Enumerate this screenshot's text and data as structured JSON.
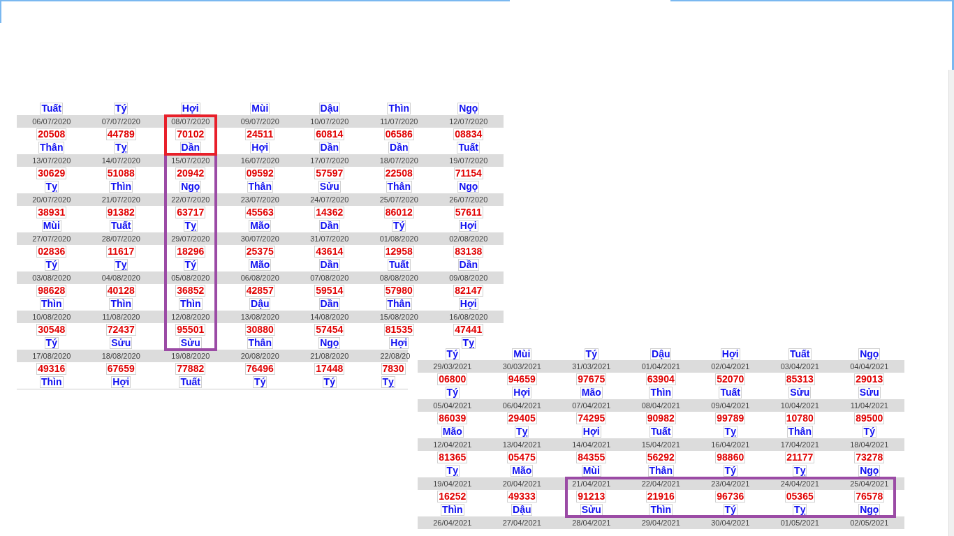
{
  "tables": [
    {
      "weeks": [
        {
          "days": [
            {
              "zodiac": "Tuất"
            },
            {
              "zodiac": "Tý"
            },
            {
              "zodiac": "Hợi"
            },
            {
              "zodiac": "Mùi"
            },
            {
              "zodiac": "Dậu"
            },
            {
              "zodiac": "Thìn"
            },
            {
              "zodiac": "Ngọ"
            }
          ]
        },
        {
          "days": [
            {
              "date": "06/07/2020",
              "number": "20508",
              "zodiac": "Thân"
            },
            {
              "date": "07/07/2020",
              "number": "44789",
              "zodiac": "Tỵ"
            },
            {
              "date": "08/07/2020",
              "number": "70102",
              "zodiac": "Dần",
              "frames": [
                {
                  "color": "#e8202a"
                }
              ]
            },
            {
              "date": "09/07/2020",
              "number": "24511",
              "zodiac": "Hợi"
            },
            {
              "date": "10/07/2020",
              "number": "60814",
              "zodiac": "Dần"
            },
            {
              "date": "11/07/2020",
              "number": "06586",
              "zodiac": "Dần"
            },
            {
              "date": "12/07/2020",
              "number": "08834",
              "zodiac": "Tuất"
            }
          ]
        },
        {
          "days": [
            {
              "date": "13/07/2020",
              "number": "30629",
              "zodiac": "Tỵ"
            },
            {
              "date": "14/07/2020",
              "number": "51088",
              "zodiac": "Thìn"
            },
            {
              "date": "15/07/2020",
              "number": "20942",
              "zodiac": "Ngọ",
              "frames": [
                {
                  "color": "#9b4ba5"
                }
              ]
            },
            {
              "date": "16/07/2020",
              "number": "09592",
              "zodiac": "Thân"
            },
            {
              "date": "17/07/2020",
              "number": "57597",
              "zodiac": "Sửu"
            },
            {
              "date": "18/07/2020",
              "number": "22508",
              "zodiac": "Thân"
            },
            {
              "date": "19/07/2020",
              "number": "71154",
              "zodiac": "Ngọ"
            }
          ]
        },
        {
          "days": [
            {
              "date": "20/07/2020",
              "number": "38931",
              "zodiac": "Mùi"
            },
            {
              "date": "21/07/2020",
              "number": "91382",
              "zodiac": "Tuất"
            },
            {
              "date": "22/07/2020",
              "number": "63717",
              "zodiac": "Tỵ",
              "frames": [
                {
                  "color": "#9b4ba5"
                }
              ]
            },
            {
              "date": "23/07/2020",
              "number": "45563",
              "zodiac": "Mão"
            },
            {
              "date": "24/07/2020",
              "number": "14362",
              "zodiac": "Dần"
            },
            {
              "date": "25/07/2020",
              "number": "86012",
              "zodiac": "Tý"
            },
            {
              "date": "26/07/2020",
              "number": "57611",
              "zodiac": "Hợi"
            }
          ]
        },
        {
          "days": [
            {
              "date": "27/07/2020",
              "number": "02836",
              "zodiac": "Tý"
            },
            {
              "date": "28/07/2020",
              "number": "11617",
              "zodiac": "Tỵ"
            },
            {
              "date": "29/07/2020",
              "number": "18296",
              "zodiac": "Tý",
              "frames": [
                {
                  "color": "#9b4ba5"
                }
              ]
            },
            {
              "date": "30/07/2020",
              "number": "25375",
              "zodiac": "Mão"
            },
            {
              "date": "31/07/2020",
              "number": "43614",
              "zodiac": "Dần"
            },
            {
              "date": "01/08/2020",
              "number": "12958",
              "zodiac": "Tuất"
            },
            {
              "date": "02/08/2020",
              "number": "83138",
              "zodiac": "Dần"
            }
          ]
        },
        {
          "days": [
            {
              "date": "03/08/2020",
              "number": "98628",
              "zodiac": "Thìn"
            },
            {
              "date": "04/08/2020",
              "number": "40128",
              "zodiac": "Thìn"
            },
            {
              "date": "05/08/2020",
              "number": "36852",
              "zodiac": "Thìn",
              "frames": [
                {
                  "color": "#9b4ba5"
                }
              ]
            },
            {
              "date": "06/08/2020",
              "number": "42857",
              "zodiac": "Dậu"
            },
            {
              "date": "07/08/2020",
              "number": "59514",
              "zodiac": "Dần"
            },
            {
              "date": "08/08/2020",
              "number": "57980",
              "zodiac": "Thân"
            },
            {
              "date": "09/08/2020",
              "number": "82147",
              "zodiac": "Hợi"
            }
          ]
        },
        {
          "days": [
            {
              "date": "10/08/2020",
              "number": "30548",
              "zodiac": "Tý"
            },
            {
              "date": "11/08/2020",
              "number": "72437",
              "zodiac": "Sửu"
            },
            {
              "date": "12/08/2020",
              "number": "95501",
              "zodiac": "Sửu",
              "frames": [
                {
                  "color": "#9b4ba5"
                }
              ]
            },
            {
              "date": "13/08/2020",
              "number": "30880",
              "zodiac": "Thân"
            },
            {
              "date": "14/08/2020",
              "number": "57454",
              "zodiac": "Ngọ"
            },
            {
              "date": "15/08/2020",
              "number": "81535",
              "zodiac": "Hợi"
            },
            {
              "date": "16/08/2020",
              "number": "47441",
              "zodiac": "Tỵ"
            }
          ]
        },
        {
          "days": [
            {
              "date": "17/08/2020",
              "number": "49316",
              "zodiac": "Thìn"
            },
            {
              "date": "18/08/2020",
              "number": "67659",
              "zodiac": "Hợi"
            },
            {
              "date": "19/08/2020",
              "number": "77882",
              "zodiac": "Tuất"
            },
            {
              "date": "20/08/2020",
              "number": "76496",
              "zodiac": "Tý"
            },
            {
              "date": "21/08/2020",
              "number": "17448",
              "zodiac": "Tý"
            },
            {
              "date": "22/08/20",
              "number": "7830",
              "zodiac": "Tỵ",
              "cut": true
            }
          ]
        }
      ]
    },
    {
      "weeks": [
        {
          "days": [
            {
              "zodiac": "Tý"
            },
            {
              "zodiac": "Mùi"
            },
            {
              "zodiac": "Tý"
            },
            {
              "zodiac": "Dậu"
            },
            {
              "zodiac": "Hợi"
            },
            {
              "zodiac": "Tuất"
            },
            {
              "zodiac": "Ngọ"
            }
          ]
        },
        {
          "days": [
            {
              "date": "29/03/2021",
              "number": "06800",
              "zodiac": "Tý"
            },
            {
              "date": "30/03/2021",
              "number": "94659",
              "zodiac": "Hợi"
            },
            {
              "date": "31/03/2021",
              "number": "97675",
              "zodiac": "Mão"
            },
            {
              "date": "01/04/2021",
              "number": "63904",
              "zodiac": "Thìn"
            },
            {
              "date": "02/04/2021",
              "number": "52070",
              "zodiac": "Tuất"
            },
            {
              "date": "03/04/2021",
              "number": "85313",
              "zodiac": "Sửu"
            },
            {
              "date": "04/04/2021",
              "number": "29013",
              "zodiac": "Sửu"
            }
          ]
        },
        {
          "days": [
            {
              "date": "05/04/2021",
              "number": "86039",
              "zodiac": "Mão"
            },
            {
              "date": "06/04/2021",
              "number": "29405",
              "zodiac": "Tỵ"
            },
            {
              "date": "07/04/2021",
              "number": "74295",
              "zodiac": "Hợi"
            },
            {
              "date": "08/04/2021",
              "number": "90982",
              "zodiac": "Tuất"
            },
            {
              "date": "09/04/2021",
              "number": "99789",
              "zodiac": "Tỵ"
            },
            {
              "date": "10/04/2021",
              "number": "10780",
              "zodiac": "Thân"
            },
            {
              "date": "11/04/2021",
              "number": "89500",
              "zodiac": "Tý"
            }
          ]
        },
        {
          "days": [
            {
              "date": "12/04/2021",
              "number": "81365",
              "zodiac": "Tỵ"
            },
            {
              "date": "13/04/2021",
              "number": "05475",
              "zodiac": "Mão"
            },
            {
              "date": "14/04/2021",
              "number": "84355",
              "zodiac": "Mùi"
            },
            {
              "date": "15/04/2021",
              "number": "56292",
              "zodiac": "Thân"
            },
            {
              "date": "16/04/2021",
              "number": "98860",
              "zodiac": "Tý"
            },
            {
              "date": "17/04/2021",
              "number": "21177",
              "zodiac": "Tỵ"
            },
            {
              "date": "18/04/2021",
              "number": "73278",
              "zodiac": "Ngọ"
            }
          ]
        },
        {
          "days": [
            {
              "date": "19/04/2021",
              "number": "16252",
              "zodiac": "Thìn"
            },
            {
              "date": "20/04/2021",
              "number": "49333",
              "zodiac": "Dậu"
            },
            {
              "date": "21/04/2021",
              "number": "91213",
              "zodiac": "Sửu",
              "frames": [
                {
                  "color": "#9b4ba5"
                }
              ]
            },
            {
              "date": "22/04/2021",
              "number": "21916",
              "zodiac": "Thìn",
              "frames": [
                {
                  "color": "#9b4ba5"
                }
              ]
            },
            {
              "date": "23/04/2021",
              "number": "96736",
              "zodiac": "Tý",
              "frames": [
                {
                  "color": "#9b4ba5"
                }
              ]
            },
            {
              "date": "24/04/2021",
              "number": "05365",
              "zodiac": "Tỵ",
              "frames": [
                {
                  "color": "#9b4ba5"
                }
              ]
            },
            {
              "date": "25/04/2021",
              "number": "76578",
              "zodiac": "Ngọ",
              "frames": [
                {
                  "color": "#9b4ba5"
                }
              ]
            }
          ]
        },
        {
          "days": [
            {
              "date": "26/04/2021"
            },
            {
              "date": "27/04/2021"
            },
            {
              "date": "28/04/2021"
            },
            {
              "date": "29/04/2021"
            },
            {
              "date": "30/04/2021"
            },
            {
              "date": "01/05/2021"
            },
            {
              "date": "02/05/2021"
            }
          ]
        }
      ]
    }
  ]
}
